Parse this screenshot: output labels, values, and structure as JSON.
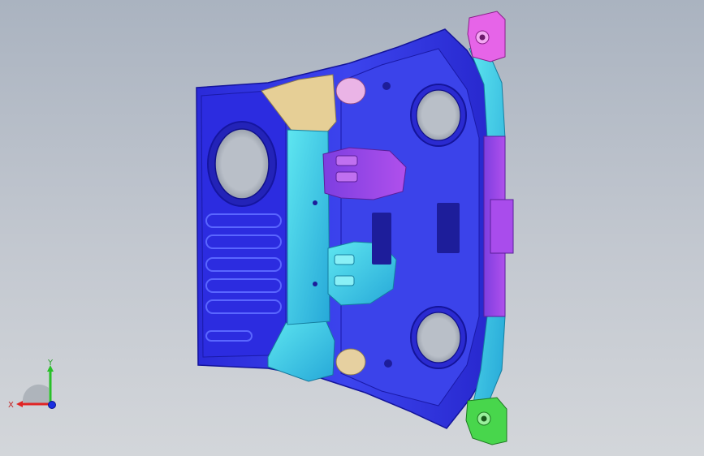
{
  "viewport": {
    "model_name": "",
    "colors": {
      "background_top": "#aab3c0",
      "background_bottom": "#d3d6da",
      "panel_blue": "#2f2de6",
      "panel_blue_light": "#4b55f2",
      "cyan": "#38d8e6",
      "magenta": "#e05ce0",
      "purple": "#9b4be8",
      "tan": "#e8d29a",
      "green": "#46d84a"
    }
  },
  "triad": {
    "x_label": "X",
    "y_label": "Y",
    "z_label": "",
    "icon": "coordinate-triad-icon",
    "x_color": "#e02424",
    "y_color": "#28c028",
    "z_color": "#1a2fe0"
  }
}
